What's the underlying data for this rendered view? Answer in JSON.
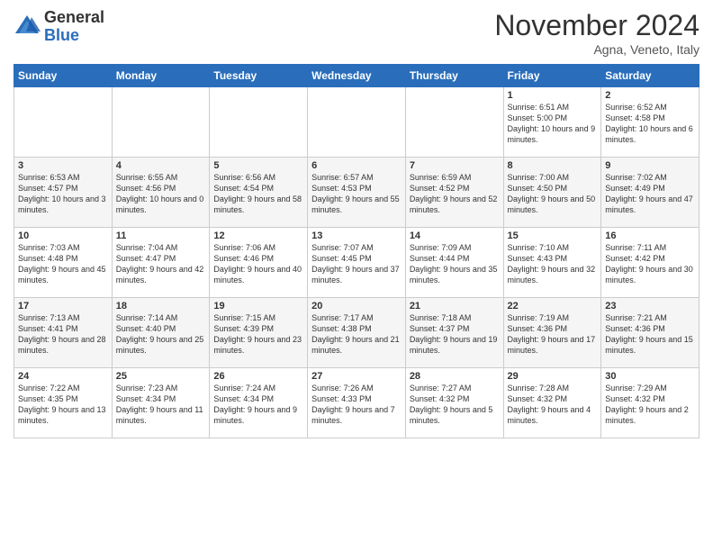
{
  "header": {
    "logo_general": "General",
    "logo_blue": "Blue",
    "month_title": "November 2024",
    "subtitle": "Agna, Veneto, Italy"
  },
  "days_of_week": [
    "Sunday",
    "Monday",
    "Tuesday",
    "Wednesday",
    "Thursday",
    "Friday",
    "Saturday"
  ],
  "weeks": [
    [
      {
        "day": "",
        "info": ""
      },
      {
        "day": "",
        "info": ""
      },
      {
        "day": "",
        "info": ""
      },
      {
        "day": "",
        "info": ""
      },
      {
        "day": "",
        "info": ""
      },
      {
        "day": "1",
        "info": "Sunrise: 6:51 AM\nSunset: 5:00 PM\nDaylight: 10 hours and 9 minutes."
      },
      {
        "day": "2",
        "info": "Sunrise: 6:52 AM\nSunset: 4:58 PM\nDaylight: 10 hours and 6 minutes."
      }
    ],
    [
      {
        "day": "3",
        "info": "Sunrise: 6:53 AM\nSunset: 4:57 PM\nDaylight: 10 hours and 3 minutes."
      },
      {
        "day": "4",
        "info": "Sunrise: 6:55 AM\nSunset: 4:56 PM\nDaylight: 10 hours and 0 minutes."
      },
      {
        "day": "5",
        "info": "Sunrise: 6:56 AM\nSunset: 4:54 PM\nDaylight: 9 hours and 58 minutes."
      },
      {
        "day": "6",
        "info": "Sunrise: 6:57 AM\nSunset: 4:53 PM\nDaylight: 9 hours and 55 minutes."
      },
      {
        "day": "7",
        "info": "Sunrise: 6:59 AM\nSunset: 4:52 PM\nDaylight: 9 hours and 52 minutes."
      },
      {
        "day": "8",
        "info": "Sunrise: 7:00 AM\nSunset: 4:50 PM\nDaylight: 9 hours and 50 minutes."
      },
      {
        "day": "9",
        "info": "Sunrise: 7:02 AM\nSunset: 4:49 PM\nDaylight: 9 hours and 47 minutes."
      }
    ],
    [
      {
        "day": "10",
        "info": "Sunrise: 7:03 AM\nSunset: 4:48 PM\nDaylight: 9 hours and 45 minutes."
      },
      {
        "day": "11",
        "info": "Sunrise: 7:04 AM\nSunset: 4:47 PM\nDaylight: 9 hours and 42 minutes."
      },
      {
        "day": "12",
        "info": "Sunrise: 7:06 AM\nSunset: 4:46 PM\nDaylight: 9 hours and 40 minutes."
      },
      {
        "day": "13",
        "info": "Sunrise: 7:07 AM\nSunset: 4:45 PM\nDaylight: 9 hours and 37 minutes."
      },
      {
        "day": "14",
        "info": "Sunrise: 7:09 AM\nSunset: 4:44 PM\nDaylight: 9 hours and 35 minutes."
      },
      {
        "day": "15",
        "info": "Sunrise: 7:10 AM\nSunset: 4:43 PM\nDaylight: 9 hours and 32 minutes."
      },
      {
        "day": "16",
        "info": "Sunrise: 7:11 AM\nSunset: 4:42 PM\nDaylight: 9 hours and 30 minutes."
      }
    ],
    [
      {
        "day": "17",
        "info": "Sunrise: 7:13 AM\nSunset: 4:41 PM\nDaylight: 9 hours and 28 minutes."
      },
      {
        "day": "18",
        "info": "Sunrise: 7:14 AM\nSunset: 4:40 PM\nDaylight: 9 hours and 25 minutes."
      },
      {
        "day": "19",
        "info": "Sunrise: 7:15 AM\nSunset: 4:39 PM\nDaylight: 9 hours and 23 minutes."
      },
      {
        "day": "20",
        "info": "Sunrise: 7:17 AM\nSunset: 4:38 PM\nDaylight: 9 hours and 21 minutes."
      },
      {
        "day": "21",
        "info": "Sunrise: 7:18 AM\nSunset: 4:37 PM\nDaylight: 9 hours and 19 minutes."
      },
      {
        "day": "22",
        "info": "Sunrise: 7:19 AM\nSunset: 4:36 PM\nDaylight: 9 hours and 17 minutes."
      },
      {
        "day": "23",
        "info": "Sunrise: 7:21 AM\nSunset: 4:36 PM\nDaylight: 9 hours and 15 minutes."
      }
    ],
    [
      {
        "day": "24",
        "info": "Sunrise: 7:22 AM\nSunset: 4:35 PM\nDaylight: 9 hours and 13 minutes."
      },
      {
        "day": "25",
        "info": "Sunrise: 7:23 AM\nSunset: 4:34 PM\nDaylight: 9 hours and 11 minutes."
      },
      {
        "day": "26",
        "info": "Sunrise: 7:24 AM\nSunset: 4:34 PM\nDaylight: 9 hours and 9 minutes."
      },
      {
        "day": "27",
        "info": "Sunrise: 7:26 AM\nSunset: 4:33 PM\nDaylight: 9 hours and 7 minutes."
      },
      {
        "day": "28",
        "info": "Sunrise: 7:27 AM\nSunset: 4:32 PM\nDaylight: 9 hours and 5 minutes."
      },
      {
        "day": "29",
        "info": "Sunrise: 7:28 AM\nSunset: 4:32 PM\nDaylight: 9 hours and 4 minutes."
      },
      {
        "day": "30",
        "info": "Sunrise: 7:29 AM\nSunset: 4:32 PM\nDaylight: 9 hours and 2 minutes."
      }
    ]
  ]
}
